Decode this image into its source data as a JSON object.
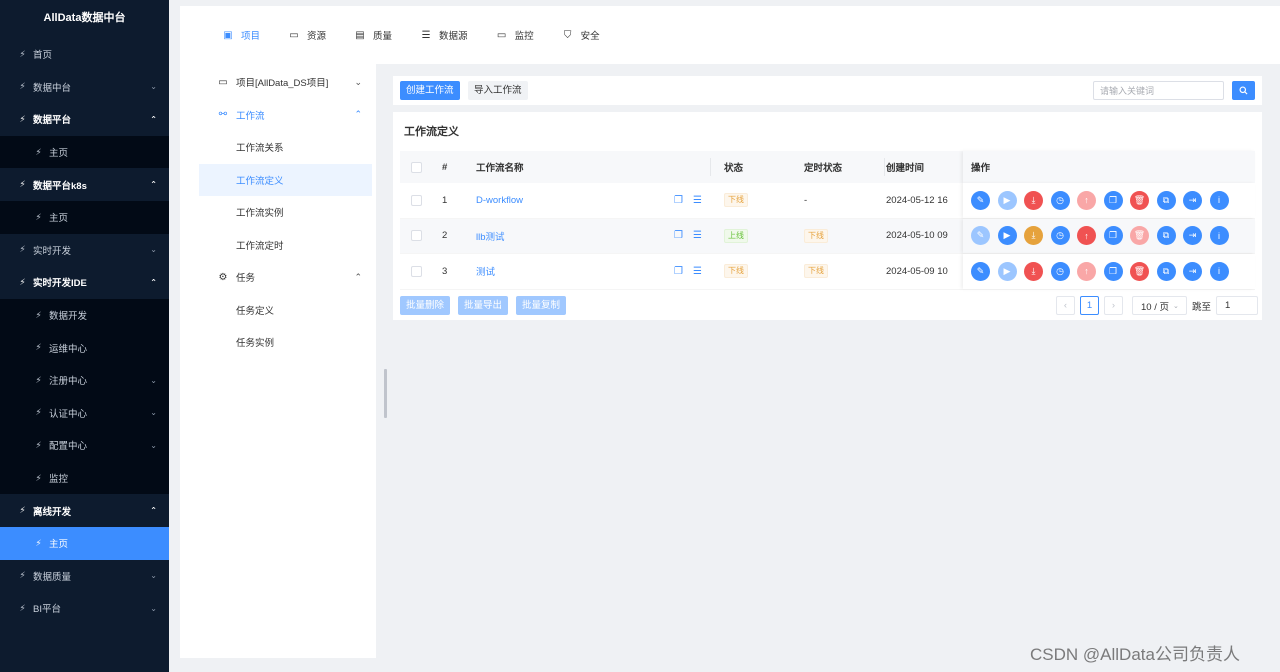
{
  "app": {
    "title": "AllData数据中台"
  },
  "sidebar": {
    "items": [
      {
        "label": "首页",
        "state": "collapsed",
        "arrow": ""
      },
      {
        "label": "数据中台",
        "state": "collapsed",
        "arrow": "⌄"
      },
      {
        "label": "数据平台",
        "state": "open",
        "arrow": "⌃"
      },
      {
        "label": "主页",
        "state": "sub",
        "arrow": ""
      },
      {
        "label": "数据平台k8s",
        "state": "open",
        "arrow": "⌃"
      },
      {
        "label": "主页",
        "state": "sub",
        "arrow": ""
      },
      {
        "label": "实时开发",
        "state": "collapsed",
        "arrow": "⌄"
      },
      {
        "label": "实时开发IDE",
        "state": "open",
        "arrow": "⌃"
      },
      {
        "label": "数据开发",
        "state": "sub",
        "arrow": ""
      },
      {
        "label": "运维中心",
        "state": "sub",
        "arrow": ""
      },
      {
        "label": "注册中心",
        "state": "sub",
        "arrow": "⌄"
      },
      {
        "label": "认证中心",
        "state": "sub",
        "arrow": "⌄"
      },
      {
        "label": "配置中心",
        "state": "sub",
        "arrow": "⌄"
      },
      {
        "label": "监控",
        "state": "sub",
        "arrow": ""
      },
      {
        "label": "离线开发",
        "state": "open",
        "arrow": "⌃"
      },
      {
        "label": "主页",
        "state": "active",
        "arrow": ""
      },
      {
        "label": "数据质量",
        "state": "collapsed",
        "arrow": "⌄"
      },
      {
        "label": "BI平台",
        "state": "collapsed",
        "arrow": "⌄"
      }
    ]
  },
  "top_tabs": [
    {
      "label": "项目",
      "icon": "project-icon",
      "active": true
    },
    {
      "label": "资源",
      "icon": "folder-icon",
      "active": false
    },
    {
      "label": "质量",
      "icon": "document-icon",
      "active": false
    },
    {
      "label": "数据源",
      "icon": "database-icon",
      "active": false
    },
    {
      "label": "监控",
      "icon": "monitor-icon",
      "active": false
    },
    {
      "label": "安全",
      "icon": "shield-icon",
      "active": false
    }
  ],
  "subnav": {
    "project": "项目[AllData_DS项目]",
    "workflow_group": "工作流",
    "workflow_items": [
      "工作流关系",
      "工作流定义",
      "工作流实例",
      "工作流定时"
    ],
    "task_group": "任务",
    "task_items": [
      "任务定义",
      "任务实例"
    ]
  },
  "toolbar": {
    "create_label": "创建工作流",
    "import_label": "导入工作流",
    "search_placeholder": "请输入关键词"
  },
  "panel": {
    "title": "工作流定义"
  },
  "table": {
    "columns": {
      "index": "#",
      "name": "工作流名称",
      "status": "状态",
      "timer": "定时状态",
      "created": "创建时间",
      "ops": "操作"
    },
    "rows": [
      {
        "index": "1",
        "name": "D-workflow",
        "status": "下线",
        "status_type": "off",
        "timer": "-",
        "timer_type": "text",
        "created": "2024-05-12 16",
        "ops": [
          "blue",
          "lblue",
          "red",
          "blue",
          "lred",
          "blue",
          "red",
          "blue",
          "blue",
          "blue"
        ]
      },
      {
        "index": "2",
        "name": "llb测试",
        "status": "上线",
        "status_type": "on",
        "timer": "下线",
        "timer_type": "tag",
        "created": "2024-05-10 09",
        "ops": [
          "lblue",
          "blue",
          "orange",
          "blue",
          "red",
          "blue",
          "lred",
          "blue",
          "blue",
          "blue"
        ]
      },
      {
        "index": "3",
        "name": "测试",
        "status": "下线",
        "status_type": "off",
        "timer": "下线",
        "timer_type": "tag",
        "created": "2024-05-09 10",
        "ops": [
          "blue",
          "lblue",
          "red",
          "blue",
          "lred",
          "blue",
          "red",
          "blue",
          "blue",
          "blue"
        ]
      }
    ],
    "op_icons": [
      "edit-icon",
      "run-icon",
      "download-icon",
      "timer-icon",
      "upload-icon",
      "copy-icon",
      "delete-icon",
      "tree-icon",
      "export-icon",
      "info-icon"
    ]
  },
  "bulk": {
    "delete_label": "批量删除",
    "export_label": "批量导出",
    "copy_label": "批量复制"
  },
  "pager": {
    "current": "1",
    "size": "10 / 页",
    "jump_label": "跳至",
    "jump_value": "1"
  },
  "watermark": "CSDN @AllData公司负责人"
}
